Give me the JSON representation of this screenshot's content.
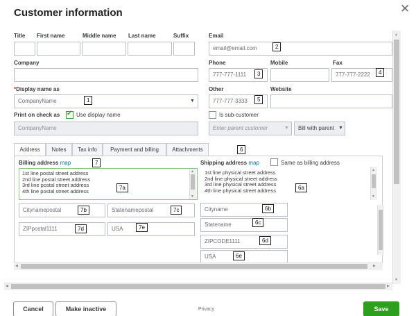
{
  "dialog": {
    "title": "Customer information",
    "close_glyph": "✕"
  },
  "name_fields": {
    "title_label": "Title",
    "first_label": "First name",
    "middle_label": "Middle name",
    "last_label": "Last name",
    "suffix_label": "Suffix"
  },
  "company": {
    "label": "Company",
    "value": ""
  },
  "display_name": {
    "required_mark": "*",
    "label": "Display name as",
    "value": "CompanyName"
  },
  "print_on_check": {
    "label": "Print on check as",
    "use_display_label": "Use display name",
    "value": "CompanyName"
  },
  "email": {
    "label": "Email",
    "value": "email@email.com"
  },
  "phone": {
    "label": "Phone",
    "value": "777-777-1111"
  },
  "mobile": {
    "label": "Mobile",
    "value": ""
  },
  "fax": {
    "label": "Fax",
    "value": "777-777-2222"
  },
  "other": {
    "label": "Other",
    "value": "777-777-3333"
  },
  "website": {
    "label": "Website",
    "value": ""
  },
  "sub_customer": {
    "label": "Is sub-customer",
    "parent_placeholder": "Enter parent customer",
    "bill_with": "Bill with parent"
  },
  "tabs": [
    {
      "label": "Address"
    },
    {
      "label": "Notes"
    },
    {
      "label": "Tax info"
    },
    {
      "label": "Payment and billing"
    },
    {
      "label": "Attachments"
    }
  ],
  "billing": {
    "label": "Billing address",
    "map_link": "map",
    "lines": [
      "1st line postal street address",
      "2nd line postal street address",
      "3rd line postal street address",
      "4th line postal street address"
    ],
    "city": "Citynamepostal",
    "state": "Statenamepostal",
    "zip": "ZIPpostal1111",
    "country": "USA"
  },
  "shipping": {
    "label": "Shipping address",
    "map_link": "map",
    "same_as_label": "Same as billing address",
    "lines": [
      "1st line physical street address",
      "2nd line physical street address",
      "3rd line physical street address",
      "4th line physical street address"
    ],
    "city": "Cityname",
    "state": "Statename",
    "zip": "ZIPCODE1111",
    "country": "USA"
  },
  "annotations": {
    "a1": "1",
    "a2": "2",
    "a3": "3",
    "a4": "4",
    "a5": "5",
    "a6": "6",
    "a7": "7",
    "a7a": "7a",
    "a7b": "7b",
    "a7c": "7c",
    "a7d": "7d",
    "a7e": "7e",
    "a6a": "6a",
    "a6b": "6b",
    "a6c": "6c",
    "a6d": "6d",
    "a6e": "6e"
  },
  "footer": {
    "cancel": "Cancel",
    "make_inactive": "Make inactive",
    "privacy": "Privacy",
    "save": "Save"
  }
}
